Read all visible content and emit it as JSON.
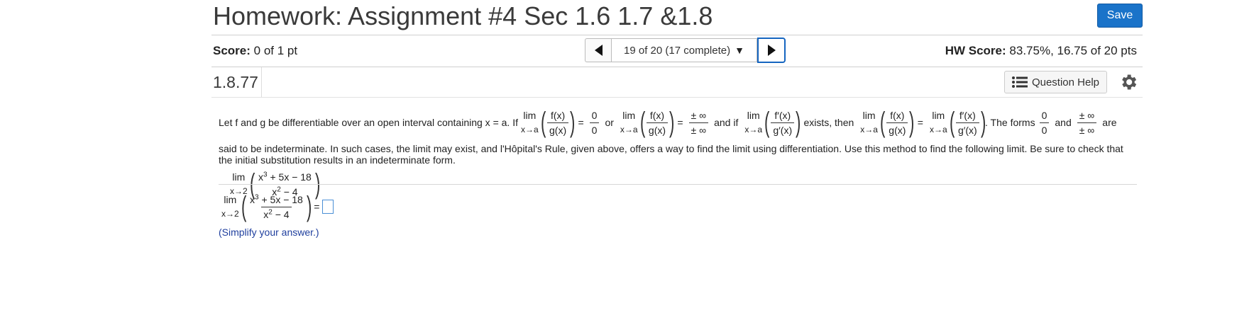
{
  "header": {
    "title": "Homework: Assignment #4 Sec 1.6 1.7 &1.8",
    "save_label": "Save"
  },
  "scorebar": {
    "score_label": "Score:",
    "score_value": "0 of 1 pt",
    "nav_text": "19 of 20 (17 complete)",
    "hw_label": "HW Score:",
    "hw_value": "83.75%, 16.75 of 20 pts"
  },
  "question": {
    "number": "1.8.77",
    "help_label": "Question Help"
  },
  "problem": {
    "t1": "Let f and g be differentiable over an open interval containing x = a. If",
    "lim": "lim",
    "x_to_a": "x→a",
    "fx": "f(x)",
    "gx": "g(x)",
    "fpx": "f′(x)",
    "gpx": "g′(x)",
    "zero": "0",
    "pm_inf": "± ∞",
    "eq": "=",
    "or": "or",
    "and_if": "and if",
    "exists_then": "exists, then",
    "forms": ". The forms",
    "and": "and",
    "are": "are",
    "para": "said to be indeterminate. In such cases, the limit may exist, and l'Hôpital's Rule,  given above, offers a way to find the limit using differentiation. Use this method to find the following limit. Be sure to check that the initial substitution results in an indeterminate form.",
    "x_to_2": "x→2",
    "expr_num_a": "x",
    "expr_num_exp": "3",
    "expr_num_b": " + 5x − 18",
    "expr_den_a": "x",
    "expr_den_exp": "2",
    "expr_den_b": " − 4"
  },
  "answer": {
    "eq": "=",
    "hint": "(Simplify your answer.)"
  },
  "colors": {
    "save_button": "#1a73c9",
    "hint_text": "#1f3f9e",
    "next_border": "#1565c0"
  }
}
